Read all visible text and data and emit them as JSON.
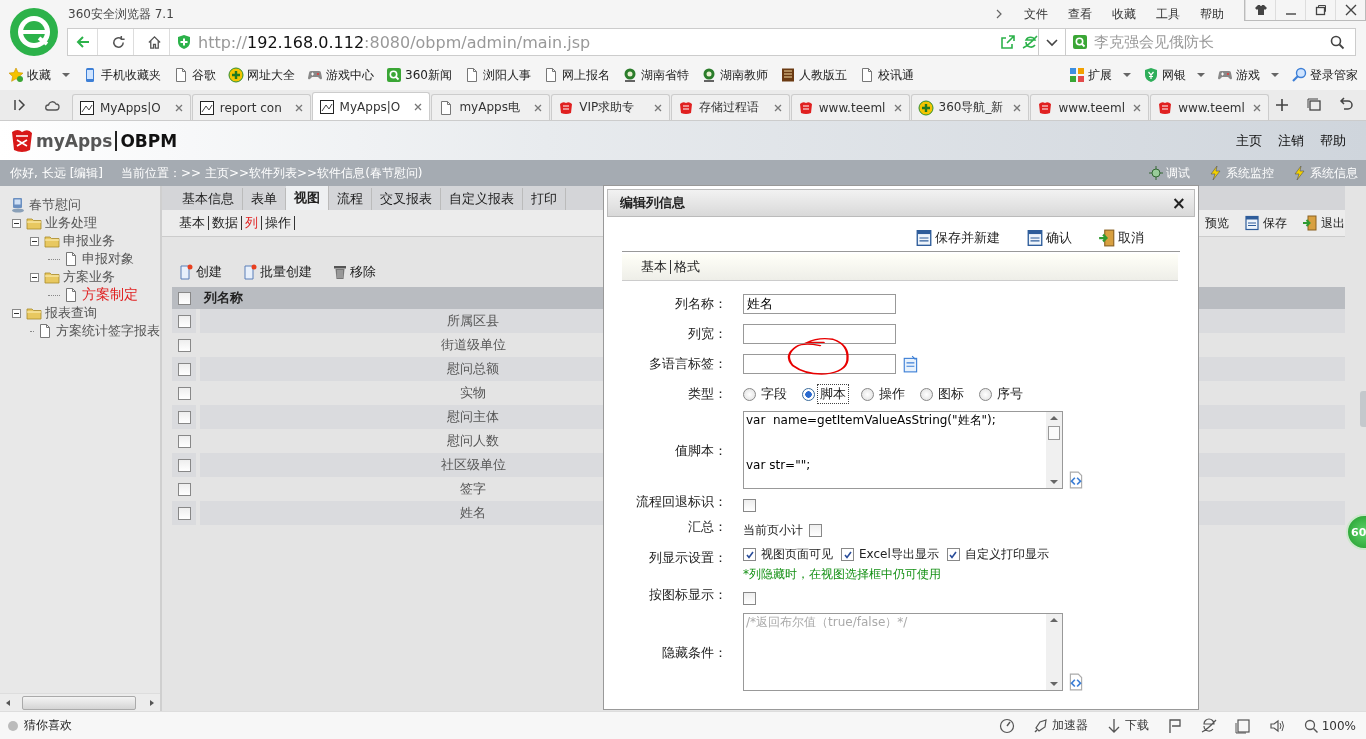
{
  "browser": {
    "title": "360安全浏览器 7.1",
    "menu": [
      "文件",
      "查看",
      "收藏",
      "工具",
      "帮助"
    ],
    "address": {
      "scheme": "http://",
      "host": "192.168.0.112",
      "path": ":8080/obpm/admin/main.jsp"
    },
    "search": {
      "placeholder": "李克强会见俄防长"
    },
    "bookmarks": [
      {
        "label": "收藏",
        "kind": "star"
      },
      {
        "label": "手机收藏夹",
        "kind": "phone"
      },
      {
        "label": "谷歌",
        "kind": "page"
      },
      {
        "label": "网址大全",
        "kind": "plus"
      },
      {
        "label": "游戏中心",
        "kind": "gamepad"
      },
      {
        "label": "360新闻",
        "kind": "search"
      },
      {
        "label": "浏阳人事",
        "kind": "page"
      },
      {
        "label": "网上报名",
        "kind": "page"
      },
      {
        "label": "湖南省特",
        "kind": "emblem"
      },
      {
        "label": "湖南教师",
        "kind": "emblem"
      },
      {
        "label": "人教版五",
        "kind": "book"
      },
      {
        "label": "校讯通",
        "kind": "page"
      }
    ],
    "extras": [
      {
        "label": "扩展",
        "kind": "grid"
      },
      {
        "label": "网银",
        "kind": "shield"
      },
      {
        "label": "游戏",
        "kind": "gamepad"
      },
      {
        "label": "登录管家",
        "kind": "key"
      }
    ],
    "tabs": [
      {
        "label": "MyApps|O",
        "kind": "app",
        "selected": false
      },
      {
        "label": "report con",
        "kind": "app",
        "selected": false
      },
      {
        "label": "MyApps|O",
        "kind": "app",
        "selected": true
      },
      {
        "label": "myApps电",
        "kind": "page",
        "selected": false
      },
      {
        "label": "VIP求助专",
        "kind": "seal",
        "selected": false
      },
      {
        "label": "存储过程语",
        "kind": "seal",
        "selected": false
      },
      {
        "label": "www.teeml",
        "kind": "seal",
        "selected": false
      },
      {
        "label": "360导航_新",
        "kind": "plus",
        "selected": false
      },
      {
        "label": "www.teeml",
        "kind": "seal",
        "selected": false
      },
      {
        "label": "www.teeml",
        "kind": "seal",
        "selected": false
      }
    ]
  },
  "app": {
    "brand": "myApps",
    "product": "OBPM",
    "nav": [
      "主页",
      "注销",
      "帮助"
    ],
    "greeting": "你好, 长远",
    "edit": "[编辑]",
    "location": "当前位置：>> 主页>>软件列表>>软件信息(春节慰问)",
    "tools": [
      "调试",
      "系统监控",
      "系统信息"
    ]
  },
  "tree": {
    "children": [
      {
        "label": "春节慰问",
        "kind": "root",
        "selected": false,
        "children": [
          {
            "label": "业务处理",
            "kind": "folder",
            "expanded": true,
            "selected": false,
            "children": [
              {
                "label": "申报业务",
                "kind": "folder",
                "expanded": true,
                "selected": false,
                "children": [
                  {
                    "label": "申报对象",
                    "kind": "page",
                    "selected": false
                  }
                ]
              },
              {
                "label": "方案业务",
                "kind": "folder",
                "expanded": true,
                "selected": false,
                "children": [
                  {
                    "label": "方案制定",
                    "kind": "page",
                    "selected": true
                  }
                ]
              }
            ]
          },
          {
            "label": "报表查询",
            "kind": "folder",
            "expanded": true,
            "selected": false,
            "children": [
              {
                "label": "方案统计签字报表",
                "kind": "page",
                "selected": false
              }
            ]
          }
        ]
      }
    ]
  },
  "content": {
    "tabs": [
      {
        "label": "基本信息",
        "selected": false
      },
      {
        "label": "表单",
        "selected": false
      },
      {
        "label": "视图",
        "selected": true
      },
      {
        "label": "流程",
        "selected": false
      },
      {
        "label": "交叉报表",
        "selected": false
      },
      {
        "label": "自定义报表",
        "selected": false
      },
      {
        "label": "打印",
        "selected": false
      }
    ],
    "subtabs": [
      {
        "label": "基本",
        "selected": false
      },
      {
        "label": "数据",
        "selected": false
      },
      {
        "label": "列",
        "selected": true
      },
      {
        "label": "操作",
        "selected": false
      }
    ],
    "page_actions": [
      {
        "label": "预览",
        "kind": "plain"
      },
      {
        "label": "保存",
        "kind": "save"
      },
      {
        "label": "退出",
        "kind": "exit"
      }
    ],
    "actions": [
      {
        "label": "创建",
        "kind": "new"
      },
      {
        "label": "批量创建",
        "kind": "new"
      },
      {
        "label": "移除",
        "kind": "trash"
      }
    ],
    "table": {
      "header": "列名称",
      "header_checked": false,
      "rows": [
        {
          "name": "所属区县",
          "checked": false
        },
        {
          "name": "街道级单位",
          "checked": false
        },
        {
          "name": "慰问总额",
          "checked": false
        },
        {
          "name": "实物",
          "checked": false
        },
        {
          "name": "慰问主体",
          "checked": false
        },
        {
          "name": "慰问人数",
          "checked": false
        },
        {
          "name": "社区级单位",
          "checked": false
        },
        {
          "name": "签字",
          "checked": false
        },
        {
          "name": "姓名",
          "checked": false
        }
      ]
    }
  },
  "dialog": {
    "title": "编辑列信息",
    "close": "×",
    "buttons": [
      {
        "label": "保存并新建",
        "kind": "save"
      },
      {
        "label": "确认",
        "kind": "save"
      },
      {
        "label": "取消",
        "kind": "exit"
      }
    ],
    "tabs": [
      "基本",
      "格式"
    ],
    "fields": [
      {
        "kind": "text",
        "label": "列名称：",
        "value": "姓名"
      },
      {
        "kind": "text",
        "label": "列宽："
      },
      {
        "kind": "text",
        "label": "多语言标签：",
        "has_button": true
      },
      {
        "kind": "radio",
        "label": "类型：",
        "options": [
          {
            "label": "字段",
            "selected": false
          },
          {
            "label": "脚本",
            "selected": true
          },
          {
            "label": "操作",
            "selected": false
          },
          {
            "label": "图标",
            "selected": false
          },
          {
            "label": "序号",
            "selected": false
          }
        ]
      },
      {
        "kind": "code",
        "label": "值脚本：",
        "value": "var  name=getItemValueAsString(\"姓名\");\n\n\nvar str=\"\";"
      },
      {
        "kind": "checkbox",
        "label": "流程回退标识：",
        "checked": false
      },
      {
        "kind": "checkbox",
        "label": "汇总：",
        "text": "当前页小计",
        "checked": false
      },
      {
        "kind": "checks",
        "label": "列显示设置：",
        "options": [
          {
            "label": "视图页面可见",
            "checked": true
          },
          {
            "label": "Excel导出显示",
            "checked": true
          },
          {
            "label": "自定义打印显示",
            "checked": true
          }
        ],
        "note": "*列隐藏时，在视图选择框中仍可使用"
      },
      {
        "kind": "checkbox",
        "label": "按图标显示：",
        "checked": false
      },
      {
        "kind": "code",
        "label": "隐藏条件：",
        "placeholder": "/*返回布尔值（true/false）*/"
      }
    ]
  },
  "floating_badge": "60",
  "status": {
    "left": "猜你喜欢",
    "items": [
      {
        "kind": "speed"
      },
      {
        "kind": "rocket",
        "label": "加速器"
      },
      {
        "kind": "download",
        "label": "下载"
      },
      {
        "kind": "flag"
      },
      {
        "kind": "ie"
      },
      {
        "kind": "window"
      },
      {
        "kind": "sound"
      },
      {
        "kind": "zoom",
        "label": "100%"
      }
    ]
  }
}
